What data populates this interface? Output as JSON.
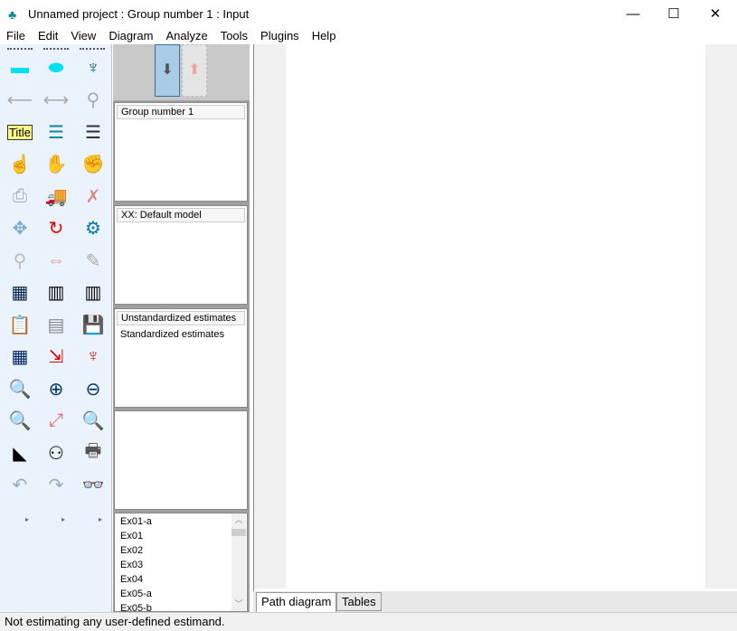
{
  "window": {
    "title": "Unnamed project : Group number 1 : Input",
    "minimize": "—",
    "maximize": "☐",
    "close": "✕"
  },
  "menu": [
    "File",
    "Edit",
    "View",
    "Diagram",
    "Analyze",
    "Tools",
    "Plugins",
    "Help"
  ],
  "toolbox": {
    "icons": [
      [
        "rectangle-icon",
        "ellipse-icon",
        "indicator-latent-icon"
      ],
      [
        "single-arrow-icon",
        "double-arrow-icon",
        "unique-variable-icon"
      ],
      [
        "title-icon",
        "list-model-variables-icon",
        "list-dataset-variables-icon"
      ],
      [
        "select-one-icon",
        "select-all-icon",
        "deselect-icon"
      ],
      [
        "duplicate-icon",
        "move-icon",
        "erase-icon"
      ],
      [
        "shape-change-icon",
        "rotate-icon",
        "reflect-icon"
      ],
      [
        "move-parameters-icon",
        "scroll-icon",
        "touch-up-icon"
      ],
      [
        "data-files-icon",
        "analysis-properties-icon",
        "calculate-estimates-icon"
      ],
      [
        "copy-clipboard-icon",
        "text-output-icon",
        "save-icon"
      ],
      [
        "object-properties-icon",
        "drag-properties-icon",
        "preserve-symmetries-icon"
      ],
      [
        "zoom-area-icon",
        "zoom-in-icon",
        "zoom-out-icon"
      ],
      [
        "view-page-icon",
        "fit-to-page-icon",
        "loupe-icon"
      ],
      [
        "bayesian-icon",
        "multiple-group-icon",
        "print-icon"
      ],
      [
        "undo-icon",
        "redo-icon",
        "specification-search-icon"
      ]
    ],
    "title_label": "Title"
  },
  "panels": {
    "groups": {
      "header": "Group number 1"
    },
    "models": {
      "header": "XX: Default model"
    },
    "estimates": {
      "header": "Unstandardized estimates",
      "items": [
        "Standardized estimates"
      ]
    },
    "files": [
      "Ex01-a",
      "Ex01",
      "Ex02",
      "Ex03",
      "Ex04",
      "Ex05-a",
      "Ex05-b"
    ]
  },
  "tabs": {
    "path_diagram": "Path diagram",
    "tables": "Tables"
  },
  "status": "Not estimating any user-defined estimand."
}
